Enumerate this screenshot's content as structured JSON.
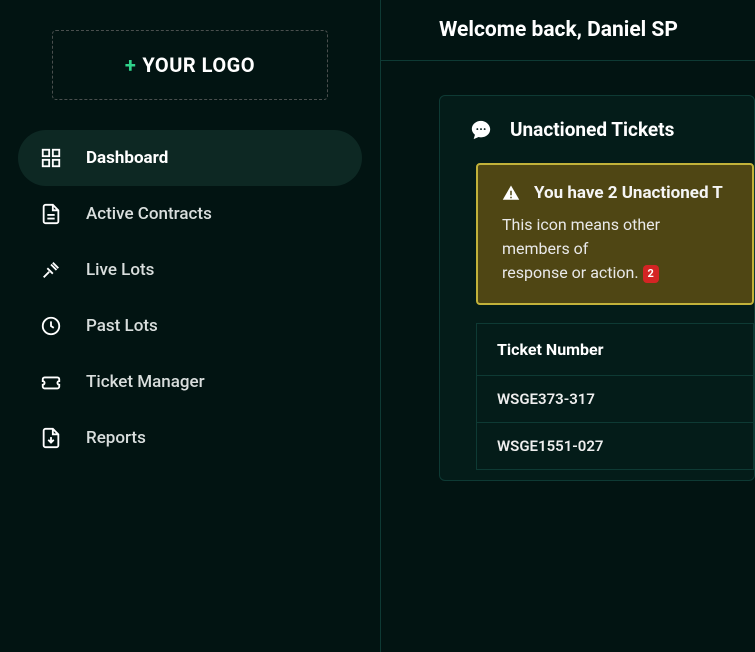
{
  "sidebar": {
    "logo_plus": "+",
    "logo_text": "YOUR LOGO",
    "items": [
      {
        "label": "Dashboard"
      },
      {
        "label": "Active Contracts"
      },
      {
        "label": "Live Lots"
      },
      {
        "label": "Past Lots"
      },
      {
        "label": "Ticket Manager"
      },
      {
        "label": "Reports"
      }
    ]
  },
  "header": {
    "welcome": "Welcome back, Daniel SP"
  },
  "unactioned": {
    "title": "Unactioned Tickets",
    "alert_title": "You have 2 Unactioned T",
    "alert_body_pre": "This icon means other members of",
    "alert_body_post": "response or action.",
    "badge_count": "2",
    "table_header": "Ticket Number",
    "rows": [
      {
        "ticket": "WSGE373-317"
      },
      {
        "ticket": "WSGE1551-027"
      }
    ]
  }
}
